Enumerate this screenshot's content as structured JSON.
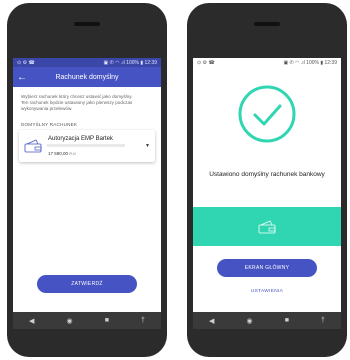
{
  "left": {
    "status_left": "⊙ ⚙ ☎",
    "status_right": "▣ ✆ ◠ .ıl 100% ▮ 12:39",
    "appbar": {
      "title": "Rachunek domyślny",
      "back_icon": "arrow-left-icon"
    },
    "info_text": "Wybierz rachunek który chcesz ustawić jako domyślny. Ten rachunek będzie ustawiony jako pierwszy podczas wykonywania przelewów.",
    "section_label": "DOMYŚLNY RACHUNEK",
    "account": {
      "name": "Autoryzacja EMP Bartek",
      "balance": "17 590,00",
      "currency": "PLN",
      "dropdown_icon": "chevron-down-icon"
    },
    "confirm_label": "ZATWIERDŹ"
  },
  "right": {
    "status_left": "⊙ ⚙ ☎",
    "status_right": "▣ ✆ ◠ .ıl 100% ▮ 12:39",
    "success_text": "Ustawiono domyślny rachunek bankowy",
    "home_label": "EKRAN GŁÓWNY",
    "settings_label": "USTAWIENIA"
  },
  "navbar": {
    "back": "◀",
    "home": "◉",
    "recents": "■",
    "extra": "†"
  },
  "colors": {
    "primary": "#4653c2",
    "teal": "#30d6b2",
    "status_bar": "#3a46a8",
    "phone_body": "#2b2b2b"
  }
}
